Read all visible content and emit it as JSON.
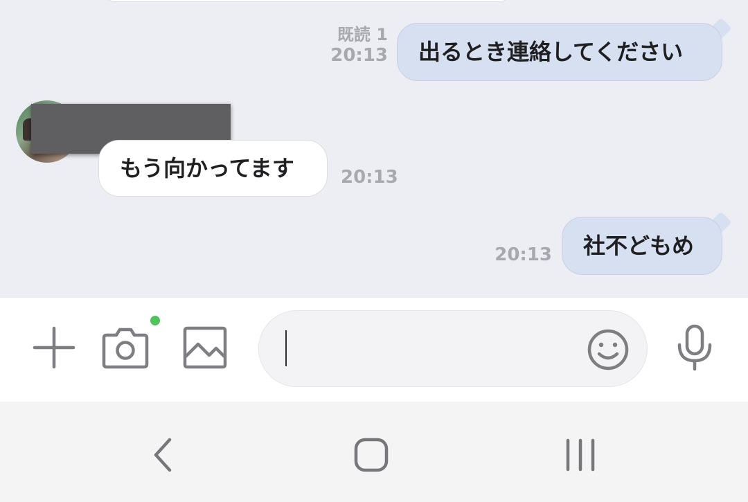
{
  "chat": {
    "messages": [
      {
        "direction": "out",
        "text": "出るとき連絡してください",
        "read_status": "既読 1",
        "time": "20:13"
      },
      {
        "direction": "in",
        "text": "もう向かってます",
        "time": "20:13"
      },
      {
        "direction": "out",
        "text": "社不どもめ",
        "time": "20:13"
      }
    ]
  },
  "input_bar": {
    "text_value": "",
    "icons": [
      "plus-icon",
      "camera-icon",
      "image-icon",
      "emoji-icon",
      "microphone-icon"
    ],
    "notification_dot": true
  },
  "navigation": {
    "icons": [
      "back-icon",
      "home-icon",
      "recents-icon"
    ]
  },
  "colors": {
    "chat_background": "#eceef3",
    "outgoing_bubble": "#d7e0f1",
    "incoming_bubble": "#ffffff",
    "timestamp": "#a7a9b0",
    "notification_dot": "#4fc25b",
    "icon_gray": "#808084"
  }
}
